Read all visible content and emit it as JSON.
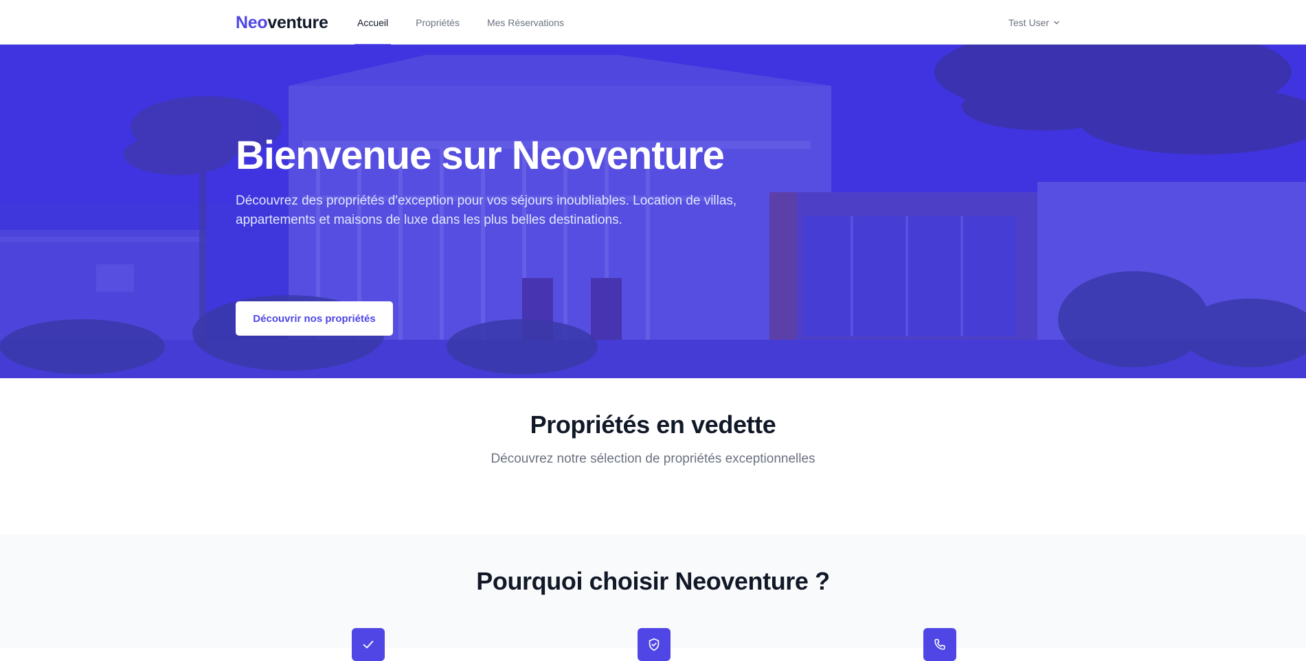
{
  "nav": {
    "brand_part1": "Neo",
    "brand_part2": "venture",
    "links": [
      {
        "label": "Accueil",
        "active": true
      },
      {
        "label": "Propriétés",
        "active": false
      },
      {
        "label": "Mes Réservations",
        "active": false
      }
    ],
    "user_name": "Test User"
  },
  "hero": {
    "title": "Bienvenue sur Neoventure",
    "subtitle": "Découvrez des propriétés d'exception pour vos séjours inoubliables. Location de villas, appartements et maisons de luxe dans les plus belles destinations.",
    "cta_label": "Découvrir nos propriétés"
  },
  "featured": {
    "title": "Propriétés en vedette",
    "subtitle": "Découvrez notre sélection de propriétés exceptionnelles"
  },
  "why": {
    "title": "Pourquoi choisir Neoventure ?",
    "icons": [
      "check-icon",
      "shield-check-icon",
      "phone-icon"
    ]
  },
  "colors": {
    "accent": "#4f46e5",
    "hero_overlay": "#4338de",
    "text_dark": "#111827",
    "text_muted": "#6b7280"
  }
}
